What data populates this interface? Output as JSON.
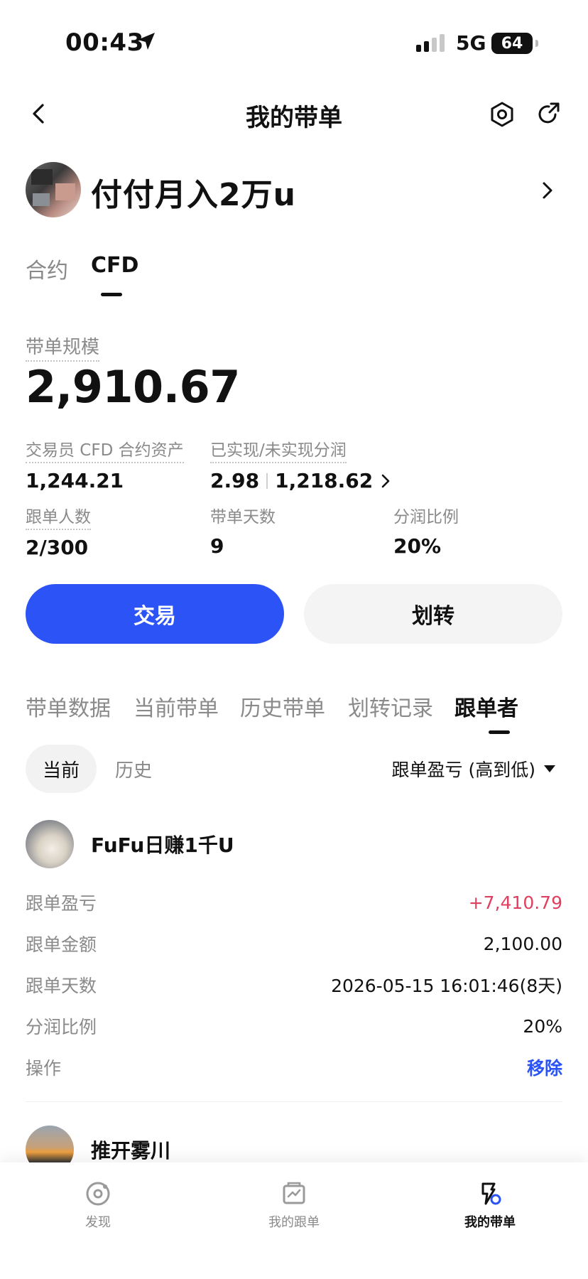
{
  "status_bar": {
    "time": "00:43",
    "network": "5G",
    "battery": "64"
  },
  "nav": {
    "title": "我的带单"
  },
  "profile": {
    "name": "付付月入2万u"
  },
  "type_tabs": [
    {
      "label": "合约"
    },
    {
      "label": "CFD"
    }
  ],
  "summary": {
    "scale_label": "带单规模",
    "scale_value": "2,910.67",
    "stats": [
      {
        "label": "交易员 CFD 合约资产",
        "value": "1,244.21"
      },
      {
        "label": "已实现/未实现分润",
        "value_realized": "2.98",
        "value_unrealized": "1,218.62"
      },
      {
        "label": "跟单人数",
        "value": "2/300"
      },
      {
        "label": "带单天数",
        "value": "9"
      },
      {
        "label": "分润比例",
        "value": "20%"
      }
    ]
  },
  "actions": {
    "trade_label": "交易",
    "transfer_label": "划转"
  },
  "data_tabs": [
    {
      "label": "带单数据"
    },
    {
      "label": "当前带单"
    },
    {
      "label": "历史带单"
    },
    {
      "label": "划转记录"
    },
    {
      "label": "跟单者"
    }
  ],
  "filter": {
    "current_label": "当前",
    "history_label": "历史",
    "sort_label": "跟单盈亏 (高到低)"
  },
  "followers": [
    {
      "name": "FuFu日赚1千U",
      "rows": [
        {
          "key": "跟单盈亏",
          "value": "+7,410.79"
        },
        {
          "key": "跟单金额",
          "value": "2,100.00"
        },
        {
          "key": "跟单天数",
          "value": "2026-05-15 16:01:46(8天)"
        },
        {
          "key": "分润比例",
          "value": "20%"
        },
        {
          "key": "操作",
          "value": "移除"
        }
      ]
    },
    {
      "name": "推开雾川"
    }
  ],
  "tab_bar": [
    {
      "label": "发现"
    },
    {
      "label": "我的跟单"
    },
    {
      "label": "我的带单"
    }
  ]
}
